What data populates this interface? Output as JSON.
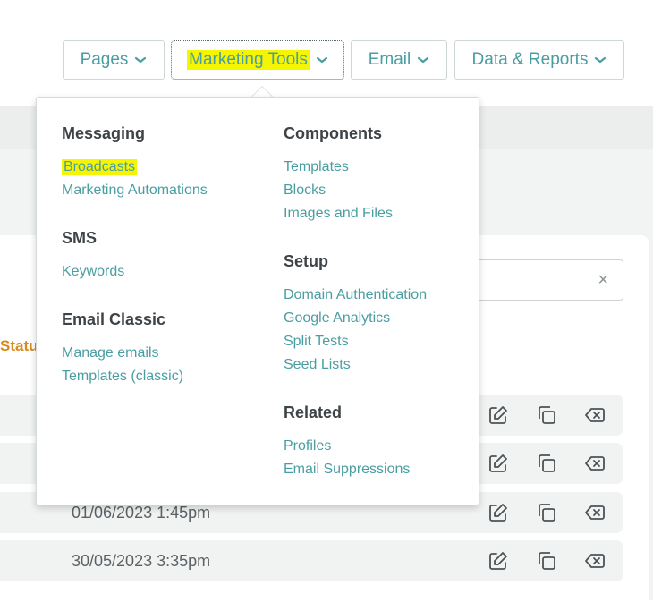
{
  "nav": {
    "pages": "Pages",
    "marketing_tools": "Marketing Tools",
    "email": "Email",
    "data_reports": "Data & Reports"
  },
  "menu": {
    "messaging": {
      "heading": "Messaging",
      "items": [
        "Broadcasts",
        "Marketing Automations"
      ]
    },
    "sms": {
      "heading": "SMS",
      "items": [
        "Keywords"
      ]
    },
    "email_classic": {
      "heading": "Email Classic",
      "items": [
        "Manage emails",
        "Templates (classic)"
      ]
    },
    "components": {
      "heading": "Components",
      "items": [
        "Templates",
        "Blocks",
        "Images and Files"
      ]
    },
    "setup": {
      "heading": "Setup",
      "items": [
        "Domain Authentication",
        "Google Analytics",
        "Split Tests",
        "Seed Lists"
      ]
    },
    "related": {
      "heading": "Related",
      "items": [
        "Profiles",
        "Email Suppressions"
      ]
    }
  },
  "page": {
    "status_label": "Statu",
    "search_clear": "×",
    "rows": [
      {
        "date": ""
      },
      {
        "date": ""
      },
      {
        "date": "01/06/2023 1:45pm"
      },
      {
        "date": "30/05/2023 3:35pm"
      }
    ]
  },
  "colors": {
    "link": "#4a9ea2",
    "highlight": "#f5f500",
    "status": "#d88a1c"
  },
  "icons": [
    "chevron-down-icon",
    "close-icon",
    "edit-icon",
    "copy-icon",
    "delete-icon"
  ]
}
